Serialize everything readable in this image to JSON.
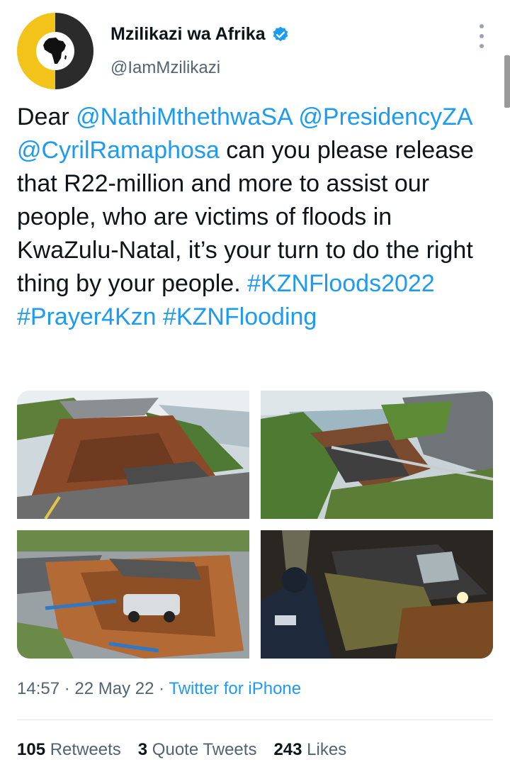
{
  "tweet": {
    "author": {
      "display_name": "Mzilikazi wa Afrika",
      "handle": "@IamMzilikazi",
      "verified": true,
      "avatar_icon": "africa-map-icon"
    },
    "text": {
      "intro": "Dear ",
      "mention_1": "@NathiMthethwaSA",
      "mention_2": "@PresidencyZA",
      "mention_3": "@CyrilRamaphosa",
      "body": " can you please release that R22-million and more to assist our people, who are victims of floods in KwaZulu-Natal, it’s your turn to do the right thing by your people. ",
      "hashtag_1": "#KZNFloods2022",
      "hashtag_2": "#Prayer4Kzn",
      "hashtag_3": "#KZNFlooding"
    },
    "media": [
      {
        "subject": "collapsed coastal road"
      },
      {
        "subject": "road washed away by flood"
      },
      {
        "subject": "sinkhole with overturned car"
      },
      {
        "subject": "police officer by flooded car at night"
      }
    ],
    "time": "14:57",
    "date": "22 May 22",
    "separator": " · ",
    "source": "Twitter for iPhone",
    "stats": {
      "retweets_count": "105",
      "retweets_label": "Retweets",
      "quotes_count": "3",
      "quotes_label": "Quote Tweets",
      "likes_count": "243",
      "likes_label": "Likes"
    }
  },
  "colors": {
    "link": "#1d9bf0",
    "text": "#0f1419",
    "muted": "#536471",
    "avatar_yellow": "#f2c318",
    "avatar_dark": "#2b2b2b"
  }
}
